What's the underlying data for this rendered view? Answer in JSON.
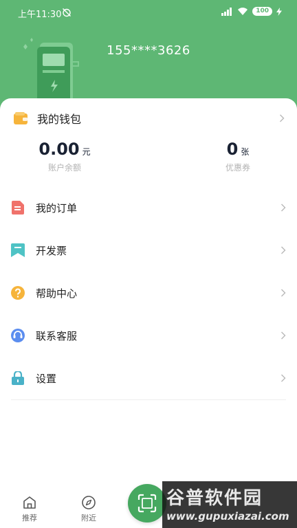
{
  "status_bar": {
    "time": "上午11:30",
    "battery": "100"
  },
  "header": {
    "phone": "155****3626"
  },
  "wallet": {
    "title": "我的钱包",
    "balance_value": "0.00",
    "balance_unit": "元",
    "balance_label": "账户余额",
    "coupon_value": "0",
    "coupon_unit": "张",
    "coupon_label": "优惠券"
  },
  "menu": {
    "items": [
      {
        "label": "我的订单",
        "icon": "order-icon",
        "color": "#f0726b"
      },
      {
        "label": "开发票",
        "icon": "invoice-icon",
        "color": "#4fc3c5"
      },
      {
        "label": "帮助中心",
        "icon": "help-icon",
        "color": "#f6b43b"
      },
      {
        "label": "联系客服",
        "icon": "customer-service-icon",
        "color": "#5b8def"
      },
      {
        "label": "设置",
        "icon": "settings-icon",
        "color": "#4ab2c8"
      }
    ]
  },
  "tabbar": {
    "home_label": "推荐",
    "nearby_label": "附近"
  },
  "watermark": {
    "text": "谷普软件园",
    "url": "www.gupuxiazai.com"
  },
  "colors": {
    "brand_green": "#5eb774",
    "wallet_yellow": "#f6b43b"
  }
}
